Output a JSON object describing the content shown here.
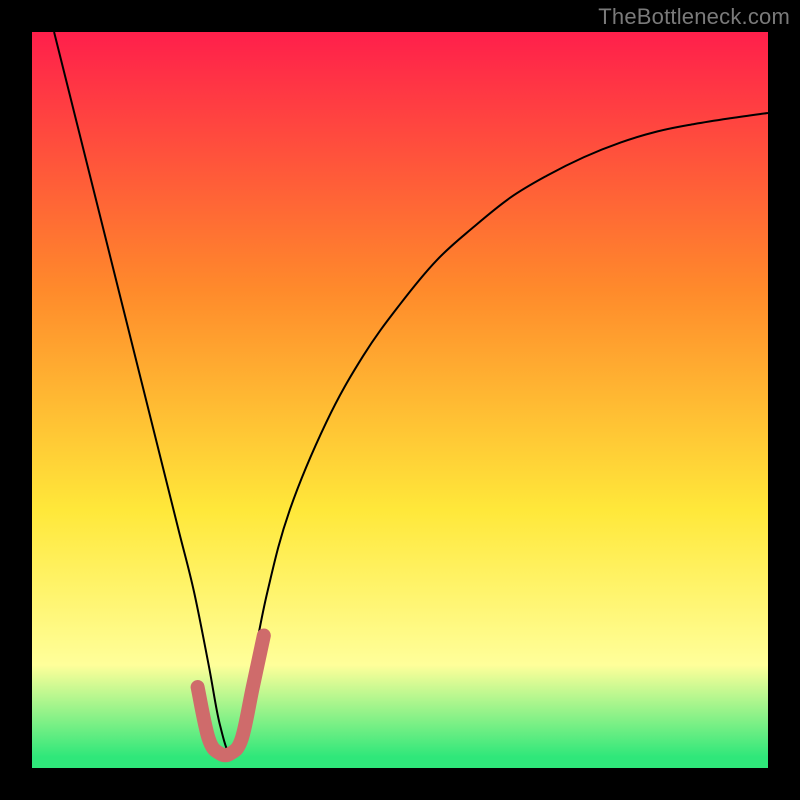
{
  "watermark": {
    "text": "TheBottleneck.com"
  },
  "chart_data": {
    "type": "line",
    "title": "",
    "xlabel": "",
    "ylabel": "",
    "xlim": [
      0,
      100
    ],
    "ylim": [
      0,
      100
    ],
    "legend": false,
    "background_gradient": {
      "top": "#ff1f4b",
      "mid1": "#ff8a2b",
      "mid2": "#ffe83a",
      "mid3": "#ffff9a",
      "bottom": "#2fe77a"
    },
    "series": [
      {
        "name": "curve",
        "stroke": "#000000",
        "x": [
          3,
          6,
          9,
          12,
          15,
          18,
          20,
          22,
          24,
          25.5,
          27,
          28.5,
          30,
          32,
          35,
          40,
          45,
          50,
          55,
          60,
          65,
          70,
          75,
          80,
          85,
          90,
          95,
          100
        ],
        "y": [
          100,
          88,
          76,
          64,
          52,
          40,
          32,
          24,
          14,
          6,
          2,
          6,
          14,
          24,
          35,
          47,
          56,
          63,
          69,
          73.5,
          77.5,
          80.5,
          83,
          85,
          86.5,
          87.5,
          88.3,
          89
        ]
      },
      {
        "name": "highlight",
        "stroke": "#cf6b6b",
        "stroke_width": 14,
        "x": [
          22.5,
          24,
          25.5,
          27,
          28.5,
          30,
          31.5
        ],
        "y": [
          11,
          4,
          2,
          2,
          4,
          11,
          18
        ]
      }
    ]
  }
}
